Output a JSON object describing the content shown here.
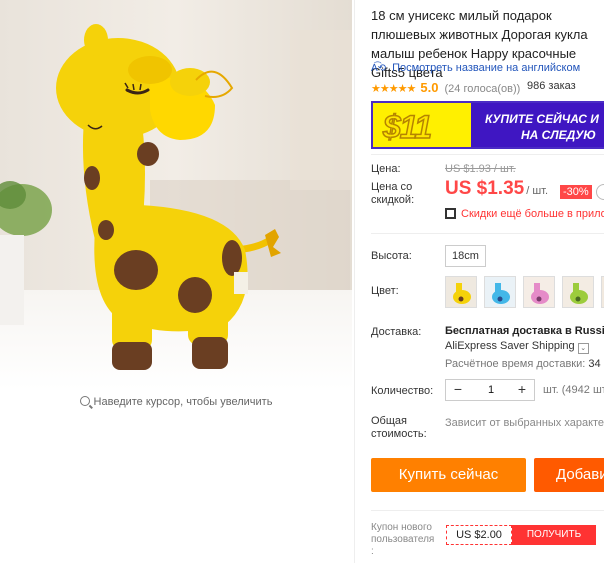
{
  "gallery": {
    "zoom_hint": "Наведите курсор, чтобы увеличить"
  },
  "product": {
    "title": "18 см унисекс милый подарок плюшевых животных Дорогая кукла малыш ребенок Happy красочные Gifts5 цвета",
    "translate_link": "Посмотреть название на английском",
    "rating": {
      "stars": "★★★★★",
      "score": "5.0",
      "votes": "(24 голоса(ов))",
      "orders": "986 заказ"
    },
    "banner": {
      "amount": "$11",
      "cta_line1": "КУПИТЕ СЕЙЧАС И",
      "cta_line2": "НА СЛЕДУЮ"
    }
  },
  "pricing": {
    "price_label": "Цена:",
    "old_price": "US $1.93 / шт.",
    "discount_label_1": "Цена со",
    "discount_label_2": "скидкой:",
    "price": "US $1.35",
    "per_unit": "/ шт.",
    "discount_badge": "-30%",
    "more_discounts": "Скидки ещё больше в прило"
  },
  "options": {
    "height_label": "Высота:",
    "height_value": "18cm",
    "color_label": "Цвет:",
    "colors": [
      "yellow",
      "blue",
      "pink",
      "green",
      "brown"
    ]
  },
  "shipping": {
    "label": "Доставка:",
    "free": "Бесплатная доставка в Russian",
    "method": "AliExpress Saver Shipping",
    "method_chevron": "⌄",
    "time_prefix": "Расчётное время доставки:",
    "time_value": "34"
  },
  "quantity": {
    "label": "Количество:",
    "minus": "−",
    "value": "1",
    "plus": "+",
    "stock": "шт. (4942 шт."
  },
  "total": {
    "label_1": "Общая",
    "label_2": "стоимость:",
    "note": "Зависит от выбранных характер"
  },
  "actions": {
    "buy_now": "Купить сейчас",
    "add_to_cart": "Добавить"
  },
  "new_user": {
    "label_1": "Купон нового",
    "label_2": "пользователя",
    "label_3": ":",
    "coupon_value": "US $2.00",
    "get_button": "ПОЛУЧИТЬ"
  },
  "colors": {
    "accent_red": "#ff4747",
    "buy_orange": "#ff8000",
    "cart_orange": "#ff5a00",
    "link_blue": "#2255bb",
    "star_orange": "#ff9a00",
    "banner_yellow": "#fff000",
    "banner_purple": "#3f16c2"
  }
}
